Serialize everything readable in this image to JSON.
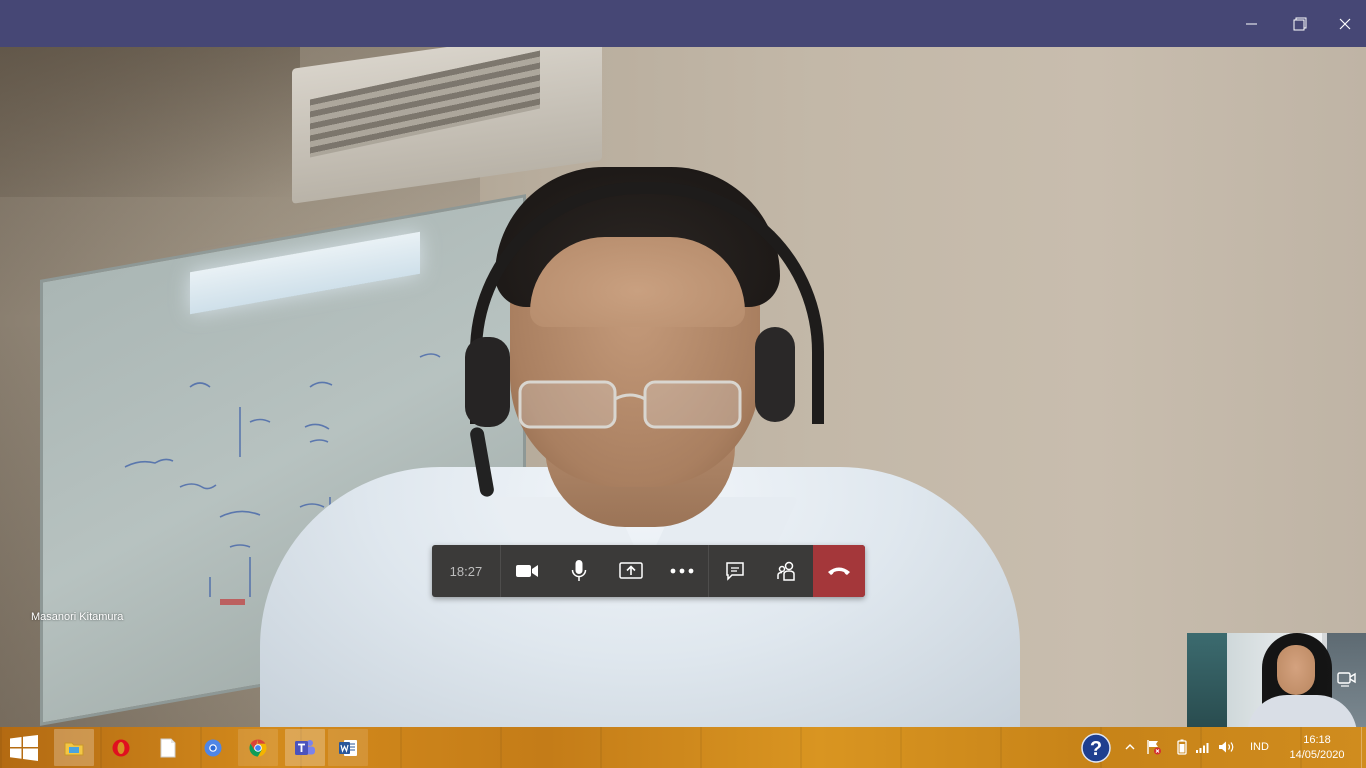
{
  "window": {
    "controls": {
      "minimize": "minimize-icon",
      "restore": "restore-icon",
      "close": "close-icon"
    },
    "titlebar_color": "#464775"
  },
  "call": {
    "participant_name": "Masanori Kitamura",
    "duration": "18:27",
    "controls": [
      "camera-icon",
      "microphone-icon",
      "share-screen-icon",
      "more-options-icon",
      "chat-icon",
      "participants-icon",
      "hang-up-icon"
    ],
    "hangup_color": "#a4373a"
  },
  "taskbar": {
    "pinned_apps": [
      "file-explorer-icon",
      "opera-icon",
      "notepad-icon",
      "chromium-icon",
      "chrome-icon",
      "teams-icon",
      "word-icon"
    ],
    "tray": {
      "icons": [
        "help-icon",
        "show-hidden-icons-icon",
        "action-center-flag-icon",
        "battery-icon",
        "network-signal-icon",
        "volume-icon"
      ],
      "language": "IND",
      "time": "16:18",
      "date": "14/05/2020"
    }
  }
}
